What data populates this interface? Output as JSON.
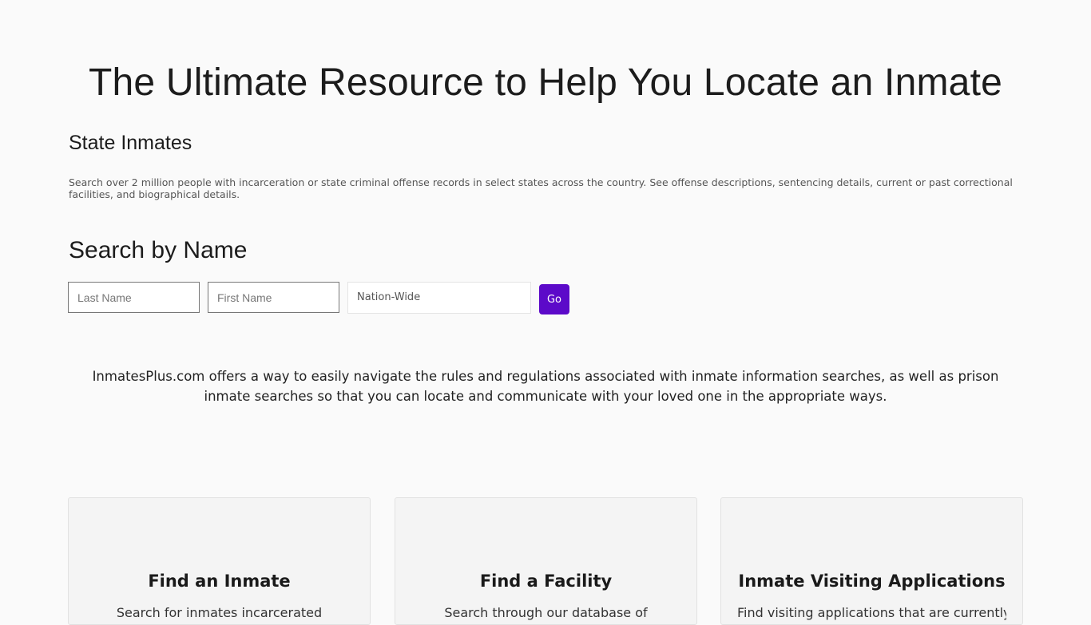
{
  "hero": {
    "title": "The Ultimate Resource to Help You Locate an Inmate"
  },
  "state_section": {
    "heading": "State Inmates",
    "description": "Search over 2 million people with incarceration or state criminal offense records in select states across the country. See offense descriptions, sentencing details, current or past correctional facilities, and biographical details."
  },
  "search": {
    "heading": "Search by Name",
    "last_name_placeholder": "Last Name",
    "first_name_placeholder": "First Name",
    "state_selected": "Nation-Wide",
    "go_label": "Go"
  },
  "intro": {
    "text": "InmatesPlus.com offers a way to easily navigate the rules and regulations associated with inmate information searches, as well as prison inmate searches so that you can locate and communicate with your loved one in the appropriate ways."
  },
  "cards": [
    {
      "title": "Find an Inmate",
      "text": "Search for inmates incarcerated"
    },
    {
      "title": "Find a Facility",
      "text": "Search through our database of"
    },
    {
      "title": "Inmate Visiting Applications",
      "text": "Find visiting applications that are currently"
    }
  ],
  "colors": {
    "background": "#fafafa",
    "accent": "#5c0ac9",
    "card_background": "#f4f4f4"
  }
}
